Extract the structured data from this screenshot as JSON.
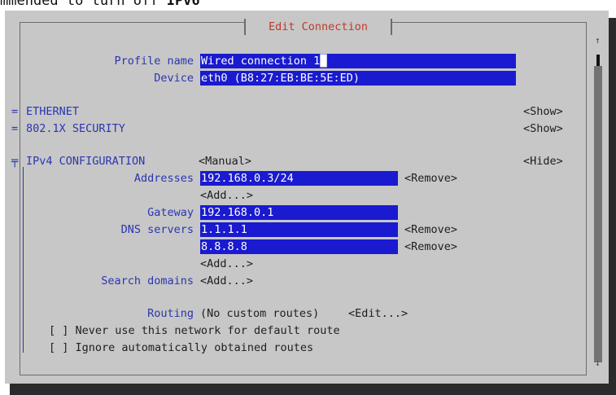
{
  "caption": {
    "prefix": "mmended to turn off ",
    "bold": "IPv6"
  },
  "dialog": {
    "title": "Edit Connection"
  },
  "profile": {
    "label": "Profile name",
    "value": "Wired connection 1"
  },
  "device": {
    "label": "Device",
    "value": "eth0 (B8:27:EB:BE:5E:ED)"
  },
  "ethernet": {
    "marker": "=",
    "label": "ETHERNET",
    "action": "<Show>"
  },
  "security": {
    "marker": "=",
    "label": "802.1X SECURITY",
    "action": "<Show>"
  },
  "ipv4": {
    "label": "IPv4 CONFIGURATION",
    "method": "<Manual>",
    "action": "<Hide>",
    "addresses_label": "Addresses",
    "addresses": [
      "192.168.0.3/24"
    ],
    "remove": "<Remove>",
    "add": "<Add...>",
    "gateway_label": "Gateway",
    "gateway": "192.168.0.1",
    "dns_label": "DNS servers",
    "dns": [
      "1.1.1.1",
      "8.8.8.8"
    ],
    "search_label": "Search domains",
    "routing_label": "Routing",
    "routing_value": "(No custom routes)",
    "routing_edit": "<Edit...>",
    "never_default": "[ ] Never use this network for default route",
    "ignore_routes": "[ ] Ignore automatically obtained routes"
  },
  "scrollbar": {
    "up": "↑",
    "down": "↓"
  }
}
